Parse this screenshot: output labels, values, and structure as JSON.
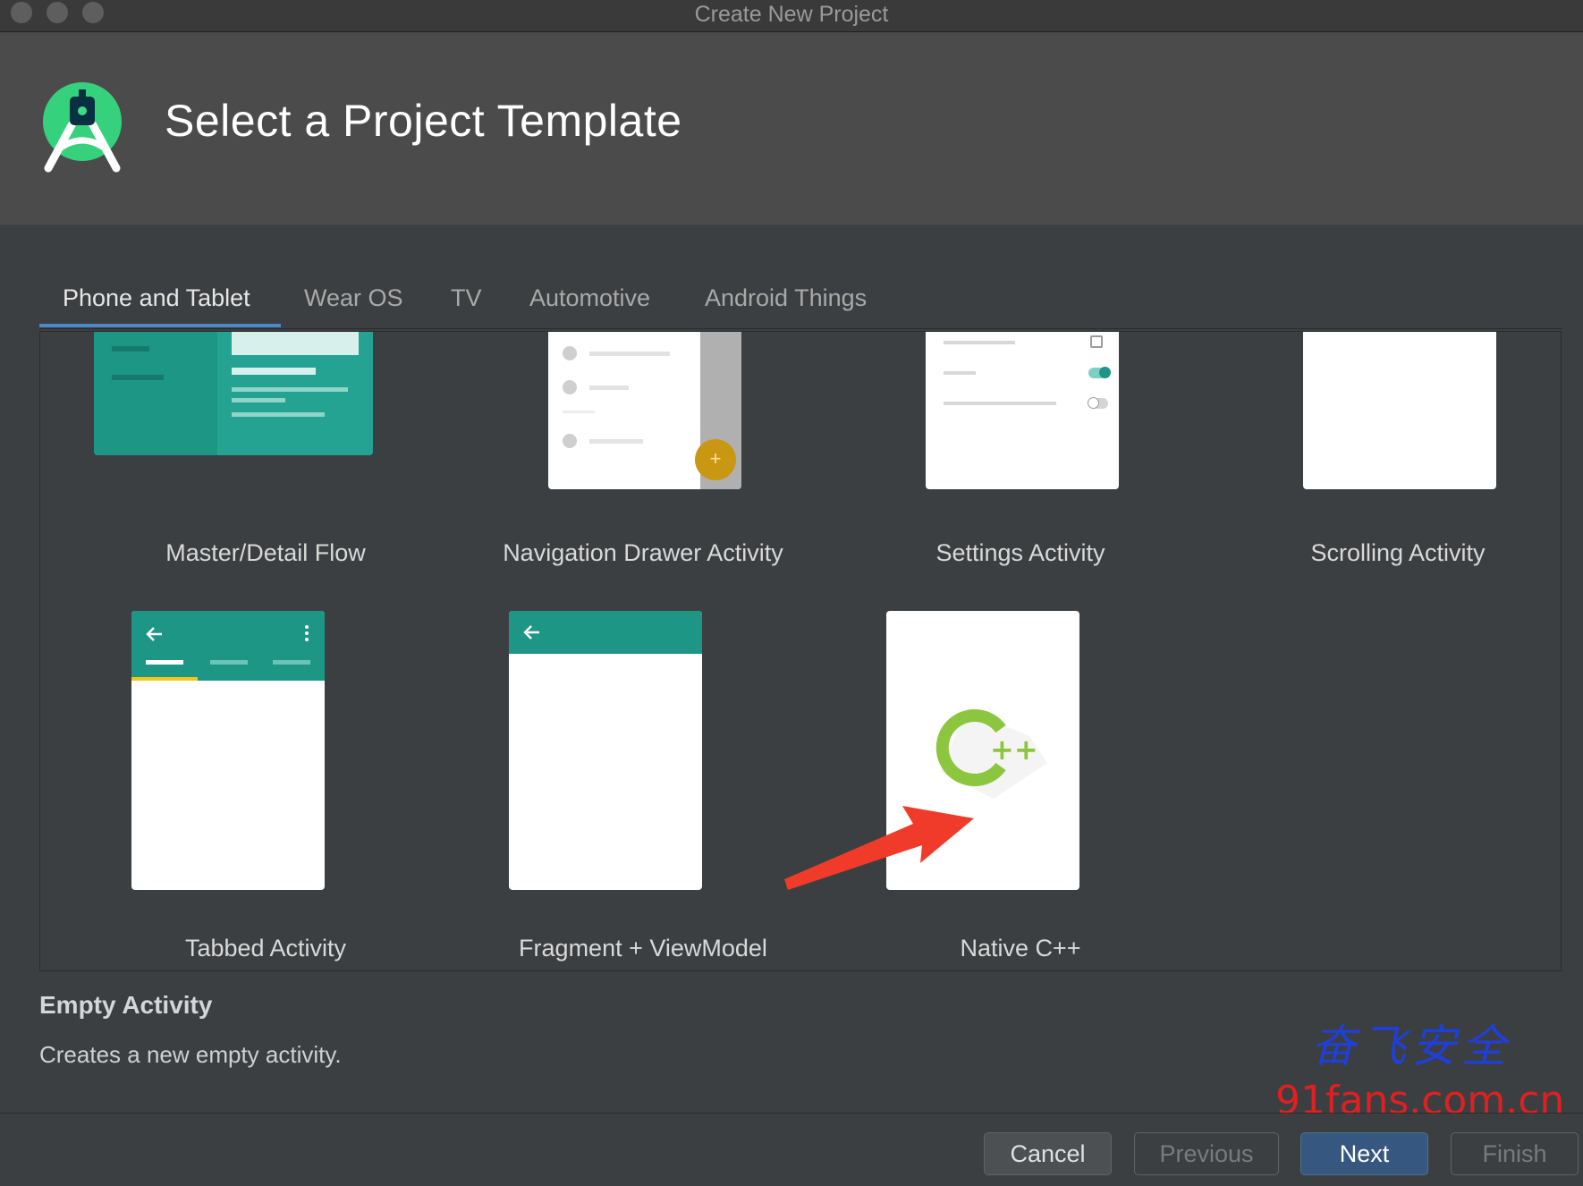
{
  "window": {
    "title": "Create New Project"
  },
  "header": {
    "title": "Select a Project Template",
    "logo_icon": "android-studio-logo"
  },
  "tabs": [
    {
      "label": "Phone and Tablet",
      "active": true
    },
    {
      "label": "Wear OS",
      "active": false
    },
    {
      "label": "TV",
      "active": false
    },
    {
      "label": "Automotive",
      "active": false
    },
    {
      "label": "Android Things",
      "active": false
    }
  ],
  "templates": [
    {
      "label": "Master/Detail Flow"
    },
    {
      "label": "Navigation Drawer Activity"
    },
    {
      "label": "Settings Activity"
    },
    {
      "label": "Scrolling Activity"
    },
    {
      "label": "Tabbed Activity"
    },
    {
      "label": "Fragment + ViewModel"
    },
    {
      "label": "Native C++",
      "badge": "++"
    }
  ],
  "description": {
    "title": "Empty Activity",
    "text": "Creates a new empty activity."
  },
  "watermark": {
    "chinese": "奋飞安全",
    "url": "91fans.com.cn"
  },
  "buttons": {
    "cancel": "Cancel",
    "previous": "Previous",
    "next": "Next",
    "finish": "Finish"
  },
  "colors": {
    "accent_teal": "#1e9686",
    "accent_blue": "#4a88c7",
    "primary_button": "#365880",
    "arrow_red": "#f03a2a",
    "cpp_green": "#8cc63f"
  }
}
